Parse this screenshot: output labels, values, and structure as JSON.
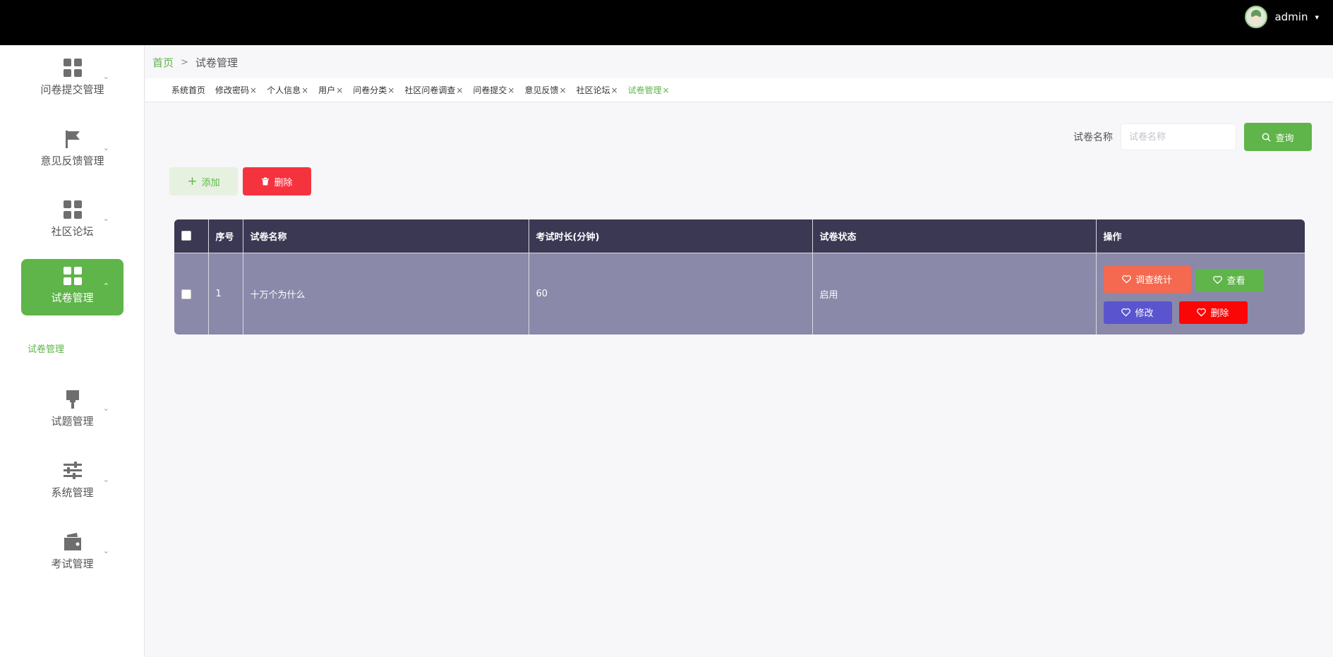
{
  "header": {
    "username": "admin",
    "caret": "▾"
  },
  "sidebar": {
    "items": [
      {
        "label": "问卷提交管理",
        "icon": "grid-icon"
      },
      {
        "label": "意见反馈管理",
        "icon": "flag-icon"
      },
      {
        "label": "社区论坛",
        "icon": "grid-icon"
      },
      {
        "label": "试卷管理",
        "icon": "grid-icon",
        "active": true
      },
      {
        "label": "试题管理",
        "icon": "brush-icon"
      },
      {
        "label": "系统管理",
        "icon": "sliders-icon"
      },
      {
        "label": "考试管理",
        "icon": "wallet-icon"
      }
    ],
    "submenu": {
      "label": "试卷管理"
    },
    "arrow": "⌄",
    "arrow_up": "⌃"
  },
  "breadcrumb": {
    "home": "首页",
    "sep": ">",
    "current": "试卷管理"
  },
  "tabs": [
    {
      "label": "系统首页",
      "closable": false
    },
    {
      "label": "修改密码",
      "closable": true
    },
    {
      "label": "个人信息",
      "closable": true
    },
    {
      "label": "用户",
      "closable": true
    },
    {
      "label": "问卷分类",
      "closable": true
    },
    {
      "label": "社区问卷调查",
      "closable": true
    },
    {
      "label": "问卷提交",
      "closable": true
    },
    {
      "label": "意见反馈",
      "closable": true
    },
    {
      "label": "社区论坛",
      "closable": true
    },
    {
      "label": "试卷管理",
      "closable": true,
      "active": true
    }
  ],
  "tab_close": "×",
  "search": {
    "label": "试卷名称",
    "placeholder": "试卷名称",
    "button": "查询"
  },
  "actions": {
    "add": "添加",
    "delete": "删除"
  },
  "table": {
    "columns": [
      "序号",
      "试卷名称",
      "考试时长(分钟)",
      "试卷状态",
      "操作"
    ],
    "rows": [
      {
        "index": "1",
        "name": "十万个为什么",
        "duration": "60",
        "status": "启用"
      }
    ],
    "row_actions": {
      "stats": "调查统计",
      "view": "查看",
      "edit": "修改",
      "delete": "删除"
    }
  },
  "colors": {
    "accent": "#5fb44a",
    "danger": "#f5333f",
    "table_header": "#3a3853",
    "table_row": "#8a89aa",
    "stats_btn": "#f4694f",
    "edit_btn": "#5a55cf",
    "delete_btn": "#fa0606"
  }
}
